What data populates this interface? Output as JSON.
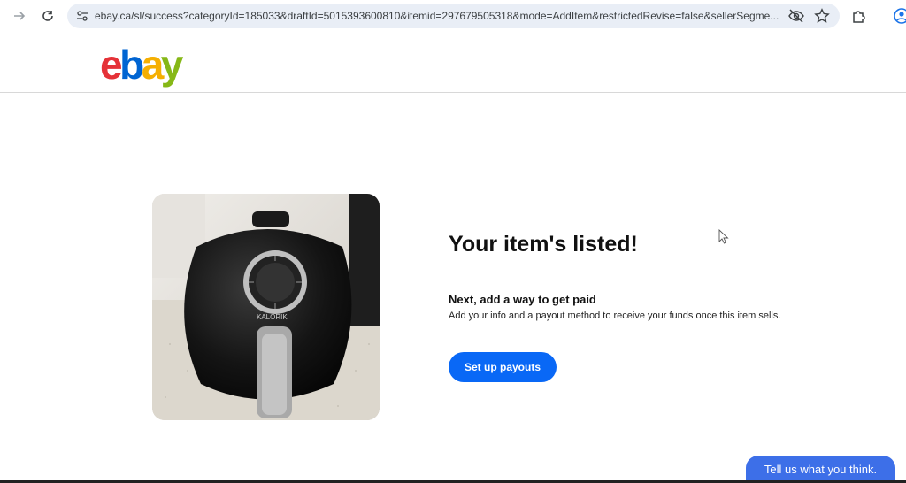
{
  "browser": {
    "url": "ebay.ca/sl/success?categoryId=185033&draftId=5015393600810&itemid=297679505318&mode=AddItem&restrictedRevise=false&sellerSegme...",
    "icons": [
      "forward-icon",
      "reload-icon",
      "site-settings-icon",
      "eye-slash-icon",
      "star-icon",
      "extensions-icon",
      "profile-icon"
    ]
  },
  "brand": {
    "logo_letters": [
      "e",
      "b",
      "a",
      "y"
    ],
    "colors": {
      "e": "#e53238",
      "b": "#0064d2",
      "a": "#f5af02",
      "y": "#86b817"
    }
  },
  "main": {
    "headline": "Your item's listed!",
    "subhead": "Next, add a way to get paid",
    "description": "Add your info and a payout method to receive your funds once this item sells.",
    "cta_label": "Set up payouts",
    "photo_brand": "KALORIK"
  },
  "feedback_label": "Tell us what you think.",
  "colors": {
    "accent": "#0968f6",
    "feedback": "#3d6fe8"
  }
}
